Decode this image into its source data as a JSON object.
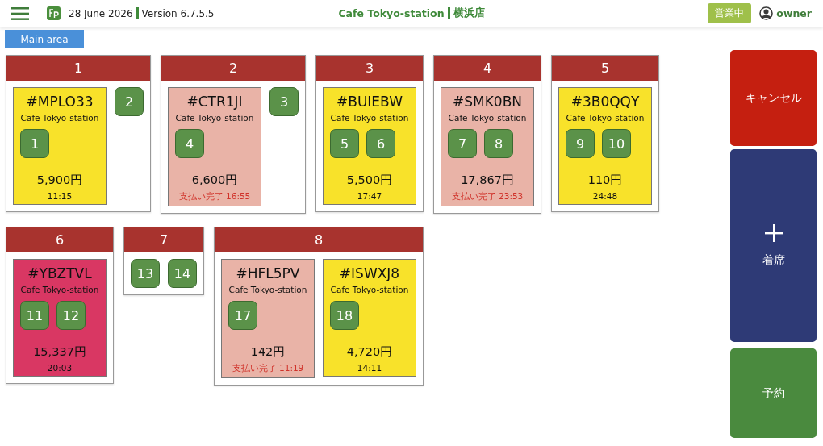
{
  "header": {
    "date": "28 June 2026",
    "version": "Version 6.7.5.5",
    "shop": "Cafe Tokyo-station",
    "branch": "横浜店",
    "status_badge": "営業中",
    "user": "owner"
  },
  "area_tabs": [
    {
      "label": "Main area",
      "selected": true
    }
  ],
  "tables": [
    {
      "name": "1",
      "orders": [
        {
          "code": "#MPLO33",
          "shop": "Cafe Tokyo-station",
          "seats": [
            "1"
          ],
          "amount": "5,900円",
          "footer": "11:15",
          "kind": "open"
        }
      ],
      "free_seats": [
        "2"
      ]
    },
    {
      "name": "2",
      "orders": [
        {
          "code": "#CTR1JI",
          "shop": "Cafe Tokyo-station",
          "seats": [
            "4"
          ],
          "amount": "6,600円",
          "footer": "支払い完了 16:55",
          "kind": "paid"
        }
      ],
      "free_seats": [
        "3"
      ]
    },
    {
      "name": "3",
      "orders": [
        {
          "code": "#BUIEBW",
          "shop": "Cafe Tokyo-station",
          "seats": [
            "5",
            "6"
          ],
          "amount": "5,500円",
          "footer": "17:47",
          "kind": "open"
        }
      ]
    },
    {
      "name": "4",
      "orders": [
        {
          "code": "#SMK0BN",
          "shop": "Cafe Tokyo-station",
          "seats": [
            "7",
            "8"
          ],
          "amount": "17,867円",
          "footer": "支払い完了 23:53",
          "kind": "paid"
        }
      ]
    },
    {
      "name": "5",
      "orders": [
        {
          "code": "#3B0QQY",
          "shop": "Cafe Tokyo-station",
          "seats": [
            "9",
            "10"
          ],
          "amount": "110円",
          "footer": "24:48",
          "kind": "open"
        }
      ]
    },
    {
      "name": "6",
      "orders": [
        {
          "code": "#YBZTVL",
          "shop": "Cafe Tokyo-station",
          "seats": [
            "11",
            "12"
          ],
          "amount": "15,337円",
          "footer": "20:03",
          "kind": "overdue"
        }
      ]
    },
    {
      "name": "7",
      "free_seats": [
        "13",
        "14"
      ]
    },
    {
      "name": "8",
      "orders": [
        {
          "code": "#HFL5PV",
          "shop": "Cafe Tokyo-station",
          "seats": [
            "17"
          ],
          "amount": "142円",
          "footer": "支払い完了 11:19",
          "kind": "paid"
        },
        {
          "code": "#ISWXJ8",
          "shop": "Cafe Tokyo-station",
          "seats": [
            "18"
          ],
          "amount": "4,720円",
          "footer": "14:11",
          "kind": "open"
        }
      ]
    }
  ],
  "actions": [
    {
      "kind": "cancel",
      "label": "キャンセル"
    },
    {
      "kind": "seat",
      "label": "着席"
    },
    {
      "kind": "reserve",
      "label": "予約"
    }
  ]
}
